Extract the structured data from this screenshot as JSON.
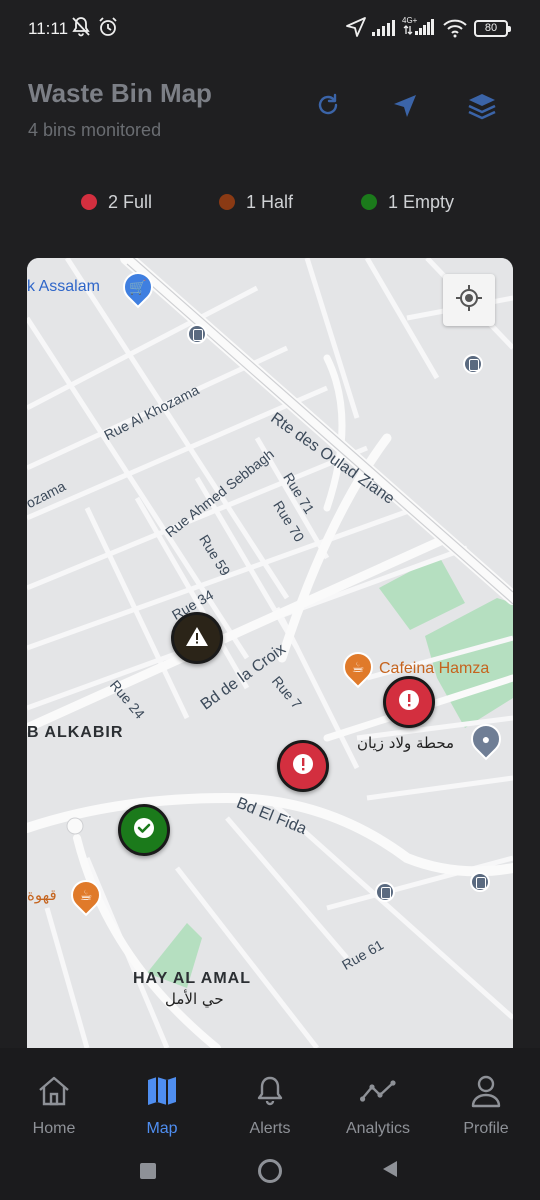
{
  "status_bar": {
    "time": "11:11",
    "network_label": "4G+",
    "battery": "80",
    "icons": [
      "bell-muted-icon",
      "alarm-icon",
      "location-arrow-icon",
      "signal-icon",
      "signal-4g-icon",
      "wifi-icon",
      "battery-icon"
    ]
  },
  "header": {
    "title": "Waste Bin Map",
    "subtitle": "4 bins monitored",
    "actions": [
      "refresh-icon",
      "navigate-icon",
      "layers-icon"
    ]
  },
  "legend": [
    {
      "label": "2 Full",
      "color": "#d32f3f"
    },
    {
      "label": "1 Half",
      "color": "#8a3a14"
    },
    {
      "label": "1 Empty",
      "color": "#1b7a1b"
    }
  ],
  "map": {
    "labels": {
      "assalam": "k Assalam",
      "rue_al_khozama": "Rue Al Khozama",
      "khozama_edge": "ozama",
      "rte_des_oulad_ziane": "Rte des Oulad Ziane",
      "rue_ahmed_sebbagh": "Rue Ahmed Sebbagh",
      "rue_71": "Rue 71",
      "rue_70": "Rue 70",
      "rue_59": "Rue 59",
      "rue_34": "Rue 34",
      "bd_de_la_croix": "Bd de la Croix",
      "cafeina_hamza": "Cafeina Hamza",
      "rue_24": "Rue 24",
      "rue_7": "Rue 7",
      "b_alkabir": "B ALKABIR",
      "arabic_station": "محطة ولاد زيان",
      "bd_el_fida": "Bd El Fida",
      "arabic_cafe": "قهوة",
      "rue_61": "Rue 61",
      "hay_al_amal": "HAY AL AMAL",
      "arabic_hay": "حي الأمل"
    },
    "markers": [
      {
        "status": "half",
        "icon": "warning-icon",
        "color": "#2b2418"
      },
      {
        "status": "full",
        "icon": "exclamation-icon",
        "color": "#d32f3f"
      },
      {
        "status": "full",
        "icon": "exclamation-icon",
        "color": "#d32f3f"
      },
      {
        "status": "empty",
        "icon": "checkmark-icon",
        "color": "#1b7a1b"
      }
    ]
  },
  "nav": {
    "items": [
      {
        "label": "Home",
        "icon": "home-icon",
        "active": false
      },
      {
        "label": "Map",
        "icon": "map-icon",
        "active": true
      },
      {
        "label": "Alerts",
        "icon": "bell-icon",
        "active": false
      },
      {
        "label": "Analytics",
        "icon": "analytics-icon",
        "active": false
      },
      {
        "label": "Profile",
        "icon": "profile-icon",
        "active": false
      }
    ],
    "active_color": "#4f8ef0"
  }
}
